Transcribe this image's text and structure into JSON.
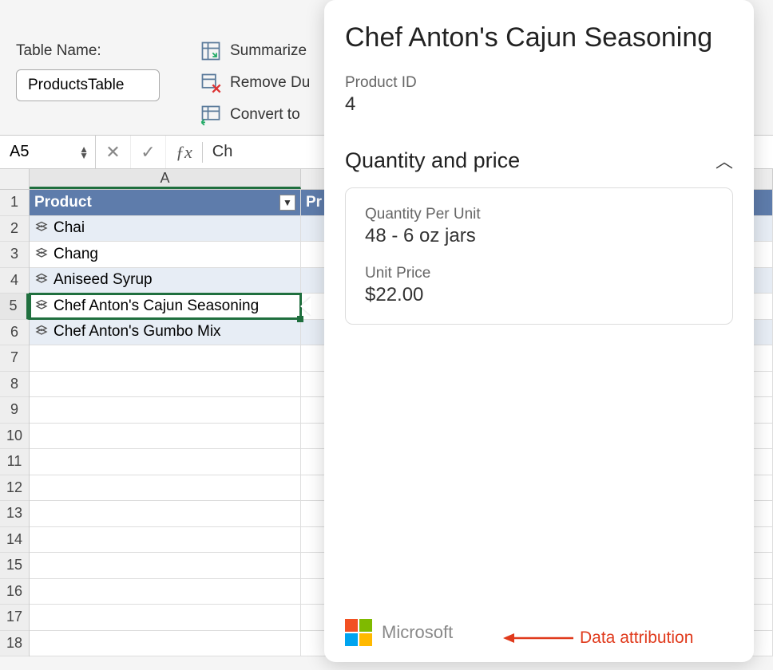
{
  "ribbon": {
    "table_name_label": "Table Name:",
    "table_name_value": "ProductsTable",
    "tools": {
      "summarize": "Summarize",
      "remove_dup": "Remove Du",
      "convert": "Convert to"
    }
  },
  "formula_bar": {
    "name_box": "A5",
    "formula_prefix": "Ch"
  },
  "grid": {
    "col_a_label": "A",
    "header_product": "Product",
    "header_next_fragment": "Pr",
    "rows": [
      "Chai",
      "Chang",
      "Aniseed Syrup",
      "Chef Anton's Cajun Seasoning",
      "Chef Anton's Gumbo Mix"
    ],
    "row_numbers": [
      1,
      2,
      3,
      4,
      5,
      6,
      7,
      8,
      9,
      10,
      11,
      12,
      13,
      14,
      15,
      16,
      17,
      18
    ]
  },
  "card": {
    "title": "Chef Anton's Cajun Seasoning",
    "product_id_label": "Product ID",
    "product_id_value": "4",
    "section_title": "Quantity and price",
    "qpu_label": "Quantity Per Unit",
    "qpu_value": "48 - 6 oz jars",
    "price_label": "Unit Price",
    "price_value": "$22.00",
    "attribution": "Microsoft"
  },
  "annotation": {
    "text": "Data attribution"
  }
}
